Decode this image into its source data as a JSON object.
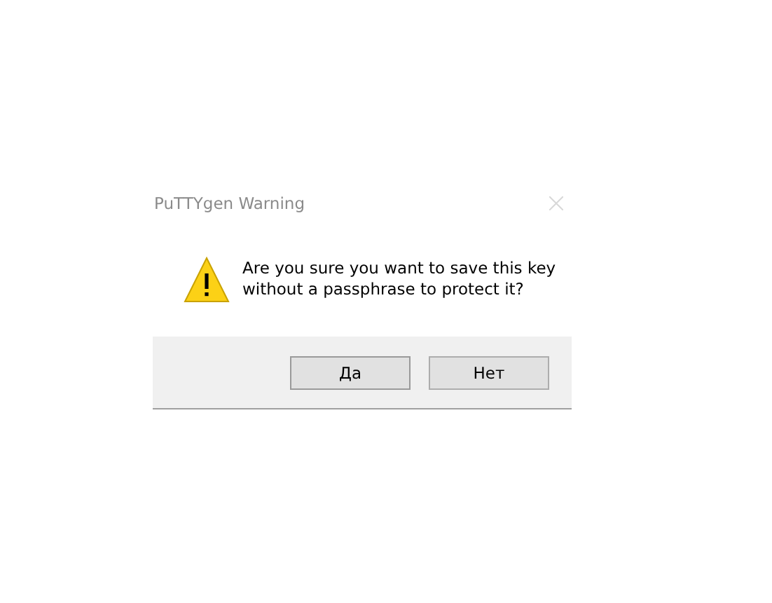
{
  "window": {
    "title": "PuTTYgen Warning"
  },
  "message": "Are you sure you want to save this key without a passphrase to protect it?",
  "buttons": [
    {
      "label": "Да",
      "kind": "default"
    },
    {
      "label": "Нет",
      "kind": "normal"
    }
  ]
}
